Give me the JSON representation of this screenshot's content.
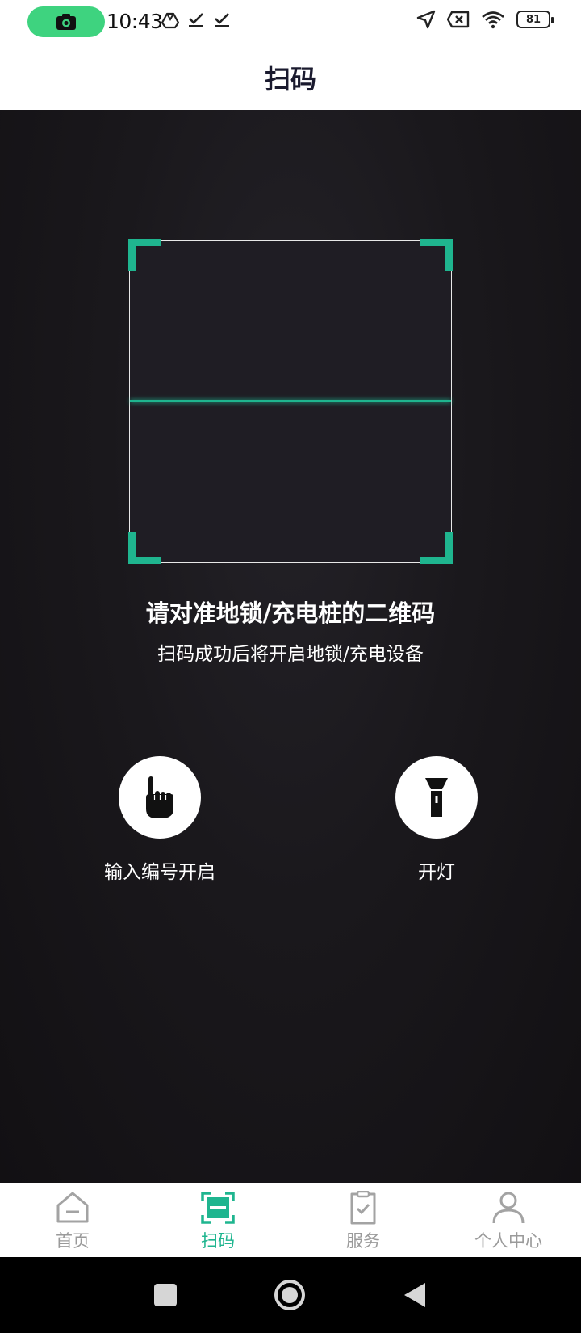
{
  "status_bar": {
    "time": "10:43",
    "battery": "81"
  },
  "header": {
    "title": "扫码"
  },
  "scanner": {
    "title": "请对准地锁/充电桩的二维码",
    "subtitle": "扫码成功后将开启地锁/充电设备"
  },
  "actions": {
    "manual_label": "输入编号开启",
    "light_label": "开灯"
  },
  "tabs": [
    {
      "label": "首页",
      "icon": "home-icon",
      "active": false
    },
    {
      "label": "扫码",
      "icon": "scan-icon",
      "active": true
    },
    {
      "label": "服务",
      "icon": "service-icon",
      "active": false
    },
    {
      "label": "个人中心",
      "icon": "person-icon",
      "active": false
    }
  ],
  "colors": {
    "accent": "#1fb58f",
    "record_pill": "#3ed37f"
  }
}
